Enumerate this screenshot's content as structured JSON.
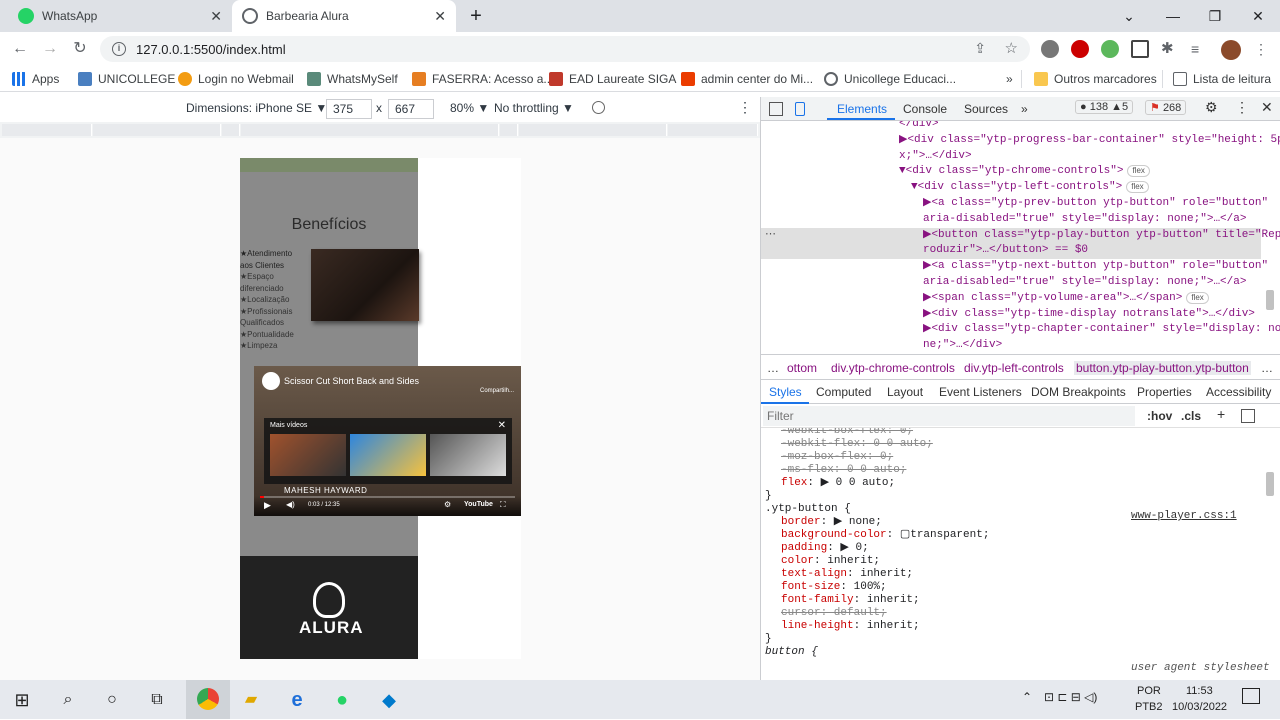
{
  "tabs": [
    {
      "title": "WhatsApp",
      "favicon": "whatsapp-icon",
      "color": "#25d366"
    },
    {
      "title": "Barbearia Alura",
      "favicon": "globe-icon",
      "color": "#5f6368"
    }
  ],
  "address": {
    "url": "127.0.0.1:5500/index.html"
  },
  "bookmarks": [
    {
      "label": "Apps"
    },
    {
      "label": "UNICOLLEGE"
    },
    {
      "label": "Login no Webmail"
    },
    {
      "label": "WhatsMySelf"
    },
    {
      "label": "FASERRA: Acesso a..."
    },
    {
      "label": "EAD Laureate SIGA"
    },
    {
      "label": "admin center do Mi..."
    },
    {
      "label": "Unicollege Educaci..."
    },
    {
      "label": "»"
    },
    {
      "label": "Outros marcadores"
    },
    {
      "label": "Lista de leitura"
    }
  ],
  "device": {
    "dimensions_label": "Dimensions: iPhone SE ▼",
    "width": "375",
    "x": "x",
    "height": "667",
    "zoom": "80% ▼",
    "throttle": "No throttling ▼"
  },
  "page": {
    "heading": "Benefícios",
    "benefits": [
      "★Atendimento aos Clientes",
      "★Espaço diferenciado",
      "★Localização",
      "★Profissionais Qualificados",
      "★Pontualidade",
      "★Limpeza"
    ],
    "video": {
      "title": "Scissor Cut Short Back and Sides",
      "more_label": "Mais vídeos",
      "channel": "MAHESH HAYWARD",
      "time": "0:03 / 12:35",
      "brand": "YouTube",
      "share": "Compartilh..."
    },
    "logo_text": "ALURA"
  },
  "devtools": {
    "tabs": [
      "Elements",
      "Console",
      "Sources",
      "»"
    ],
    "errors": "138",
    "warnings": "5",
    "issues": "268",
    "elements_lines": [
      {
        "indent": 0,
        "text": "</div>",
        "sel": false
      },
      {
        "indent": 0,
        "text": "▶<div class=\"ytp-progress-bar-container\" style=\"height: 5p",
        "sel": false
      },
      {
        "indent": 0,
        "text": "x;\">…</div>",
        "sel": false
      },
      {
        "indent": 0,
        "text": "▼<div class=\"ytp-chrome-controls\">",
        "sel": false
      },
      {
        "indent": 1,
        "text": "▼<div class=\"ytp-left-controls\">",
        "sel": false
      },
      {
        "indent": 2,
        "text": "▶<a class=\"ytp-prev-button ytp-button\" role=\"button\"",
        "sel": false
      },
      {
        "indent": 2,
        "text": " aria-disabled=\"true\" style=\"display: none;\">…</a>",
        "sel": false
      },
      {
        "indent": 2,
        "text": "▶<button class=\"ytp-play-button ytp-button\" title=\"Rep",
        "sel": true
      },
      {
        "indent": 2,
        "text": " roduzir\">…</button> == $0",
        "sel": true
      },
      {
        "indent": 2,
        "text": "▶<a class=\"ytp-next-button ytp-button\" role=\"button\"",
        "sel": false
      },
      {
        "indent": 2,
        "text": " aria-disabled=\"true\" style=\"display: none;\">…</a>",
        "sel": false
      },
      {
        "indent": 2,
        "text": "▶<span class=\"ytp-volume-area\">…</span>",
        "sel": false
      },
      {
        "indent": 2,
        "text": "▶<div class=\"ytp-time-display notranslate\">…</div>",
        "sel": false
      },
      {
        "indent": 2,
        "text": "▶<div class=\"ytp-chapter-container\" style=\"display: no",
        "sel": false
      },
      {
        "indent": 2,
        "text": " ne;\">…</div>",
        "sel": false
      }
    ],
    "flex_badge": "flex",
    "breadcrumbs": [
      "…",
      "ottom",
      "div.ytp-chrome-controls",
      "div.ytp-left-controls",
      "button.ytp-play-button.ytp-button",
      "…"
    ],
    "subtabs": [
      "Styles",
      "Computed",
      "Layout",
      "Event Listeners",
      "DOM Breakpoints",
      "Properties",
      "Accessibility"
    ],
    "filter_placeholder": "Filter",
    "hov": ":hov",
    "cls": ".cls",
    "styles_lines": [
      {
        "text": "-webkit-box-flex: 0;",
        "strike": true
      },
      {
        "text": "-webkit-flex: 0 0 auto;",
        "strike": true
      },
      {
        "text": "-moz-box-flex: 0;",
        "strike": true
      },
      {
        "text": "-ms-flex: 0 0 auto;",
        "strike": true
      },
      {
        "text": "flex: ▶ 0 0 auto;",
        "strike": false
      },
      {
        "text": "}",
        "strike": false,
        "brace": true
      },
      {
        "text": ".ytp-button {",
        "strike": false,
        "selector": true
      },
      {
        "text": "border: ▶ none;",
        "strike": false
      },
      {
        "text": "background-color: ▢transparent;",
        "strike": false
      },
      {
        "text": "padding: ▶ 0;",
        "strike": false
      },
      {
        "text": "color: inherit;",
        "strike": false
      },
      {
        "text": "text-align: inherit;",
        "strike": false
      },
      {
        "text": "font-size: 100%;",
        "strike": false
      },
      {
        "text": "font-family: inherit;",
        "strike": false
      },
      {
        "text": "cursor: default;",
        "strike": true
      },
      {
        "text": "line-height: inherit;",
        "strike": false
      },
      {
        "text": "}",
        "strike": false,
        "brace": true
      },
      {
        "text": "button {",
        "strike": false,
        "selector": true,
        "italic": true
      }
    ],
    "style_source": "www-player.css:1",
    "ua_source": "user agent stylesheet"
  },
  "taskbar": {
    "lang": "POR",
    "layout": "PTB2",
    "time": "11:53",
    "date": "10/03/2022"
  }
}
